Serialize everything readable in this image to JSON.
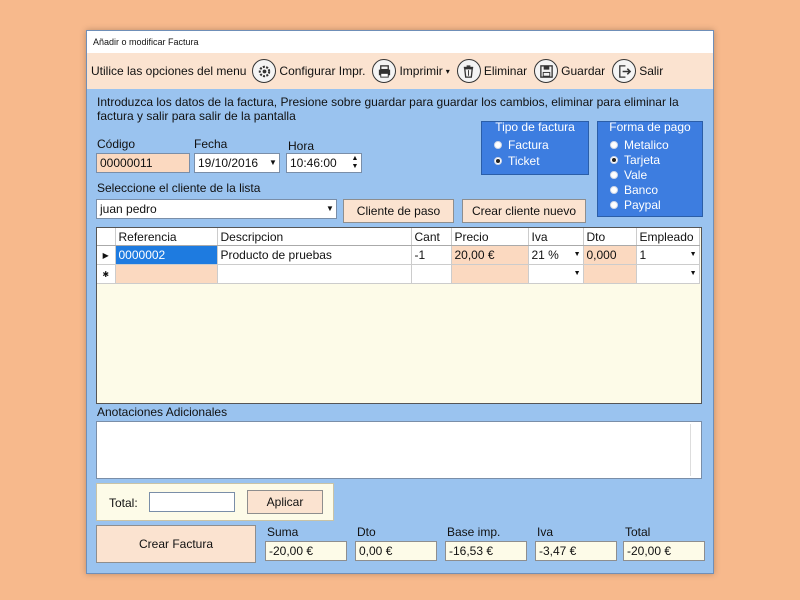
{
  "window": {
    "title": "Añadir o modificar Factura"
  },
  "toolbar": {
    "lead_text": "Utilice las opciones del menu",
    "configurar": "Configurar Impr.",
    "imprimir": "Imprimir",
    "eliminar": "Eliminar",
    "guardar": "Guardar",
    "salir": "Salir"
  },
  "intro_text": "Introduzca los datos de la factura, Presione sobre guardar para guardar los cambios, eliminar para eliminar la factura y salir para salir de la pantalla",
  "form": {
    "codigo_label": "Código",
    "codigo_value": "00000011",
    "fecha_label": "Fecha",
    "fecha_value": "19/10/2016",
    "hora_label": "Hora",
    "hora_value": "10:46:00",
    "cliente_label": "Seleccione el cliente de la lista",
    "cliente_value": "juan pedro",
    "cliente_paso_label": "Cliente de paso",
    "crear_cliente_label": "Crear cliente nuevo"
  },
  "tipo_factura": {
    "title": "Tipo de factura",
    "options": [
      "Factura",
      "Ticket"
    ],
    "selected": "Ticket"
  },
  "forma_pago": {
    "title": "Forma de pago",
    "options": [
      "Metalico",
      "Tarjeta",
      "Vale",
      "Banco",
      "Paypal"
    ],
    "selected": "Tarjeta"
  },
  "grid": {
    "columns": [
      "Referencia",
      "Descripcion",
      "Cant",
      "Precio",
      "Iva",
      "Dto",
      "Empleado"
    ],
    "row": {
      "referencia": "0000002",
      "descripcion": "Producto de pruebas",
      "cant": "-1",
      "precio": "20,00 €",
      "iva": "21 %",
      "dto": "0,000",
      "empleado": "1"
    }
  },
  "notes": {
    "label": "Anotaciones Adicionales",
    "value": ""
  },
  "total": {
    "label": "Total:",
    "value": "",
    "apply_label": "Aplicar"
  },
  "crear_factura_label": "Crear Factura",
  "summary": {
    "suma_label": "Suma",
    "suma_value": "-20,00 €",
    "dto_label": "Dto",
    "dto_value": "0,00 €",
    "base_label": "Base imp.",
    "base_value": "-16,53 €",
    "iva_label": "Iva",
    "iva_value": "-3,47 €",
    "total_label": "Total",
    "total_value": "-20,00 €"
  },
  "colors": {
    "window_bg": "#9ac3ef",
    "toolbar_bg": "#fbe3d0",
    "group_bg": "#3d7de0",
    "selected_cell": "#1e7be0",
    "peach_field": "#fbd9c0"
  }
}
